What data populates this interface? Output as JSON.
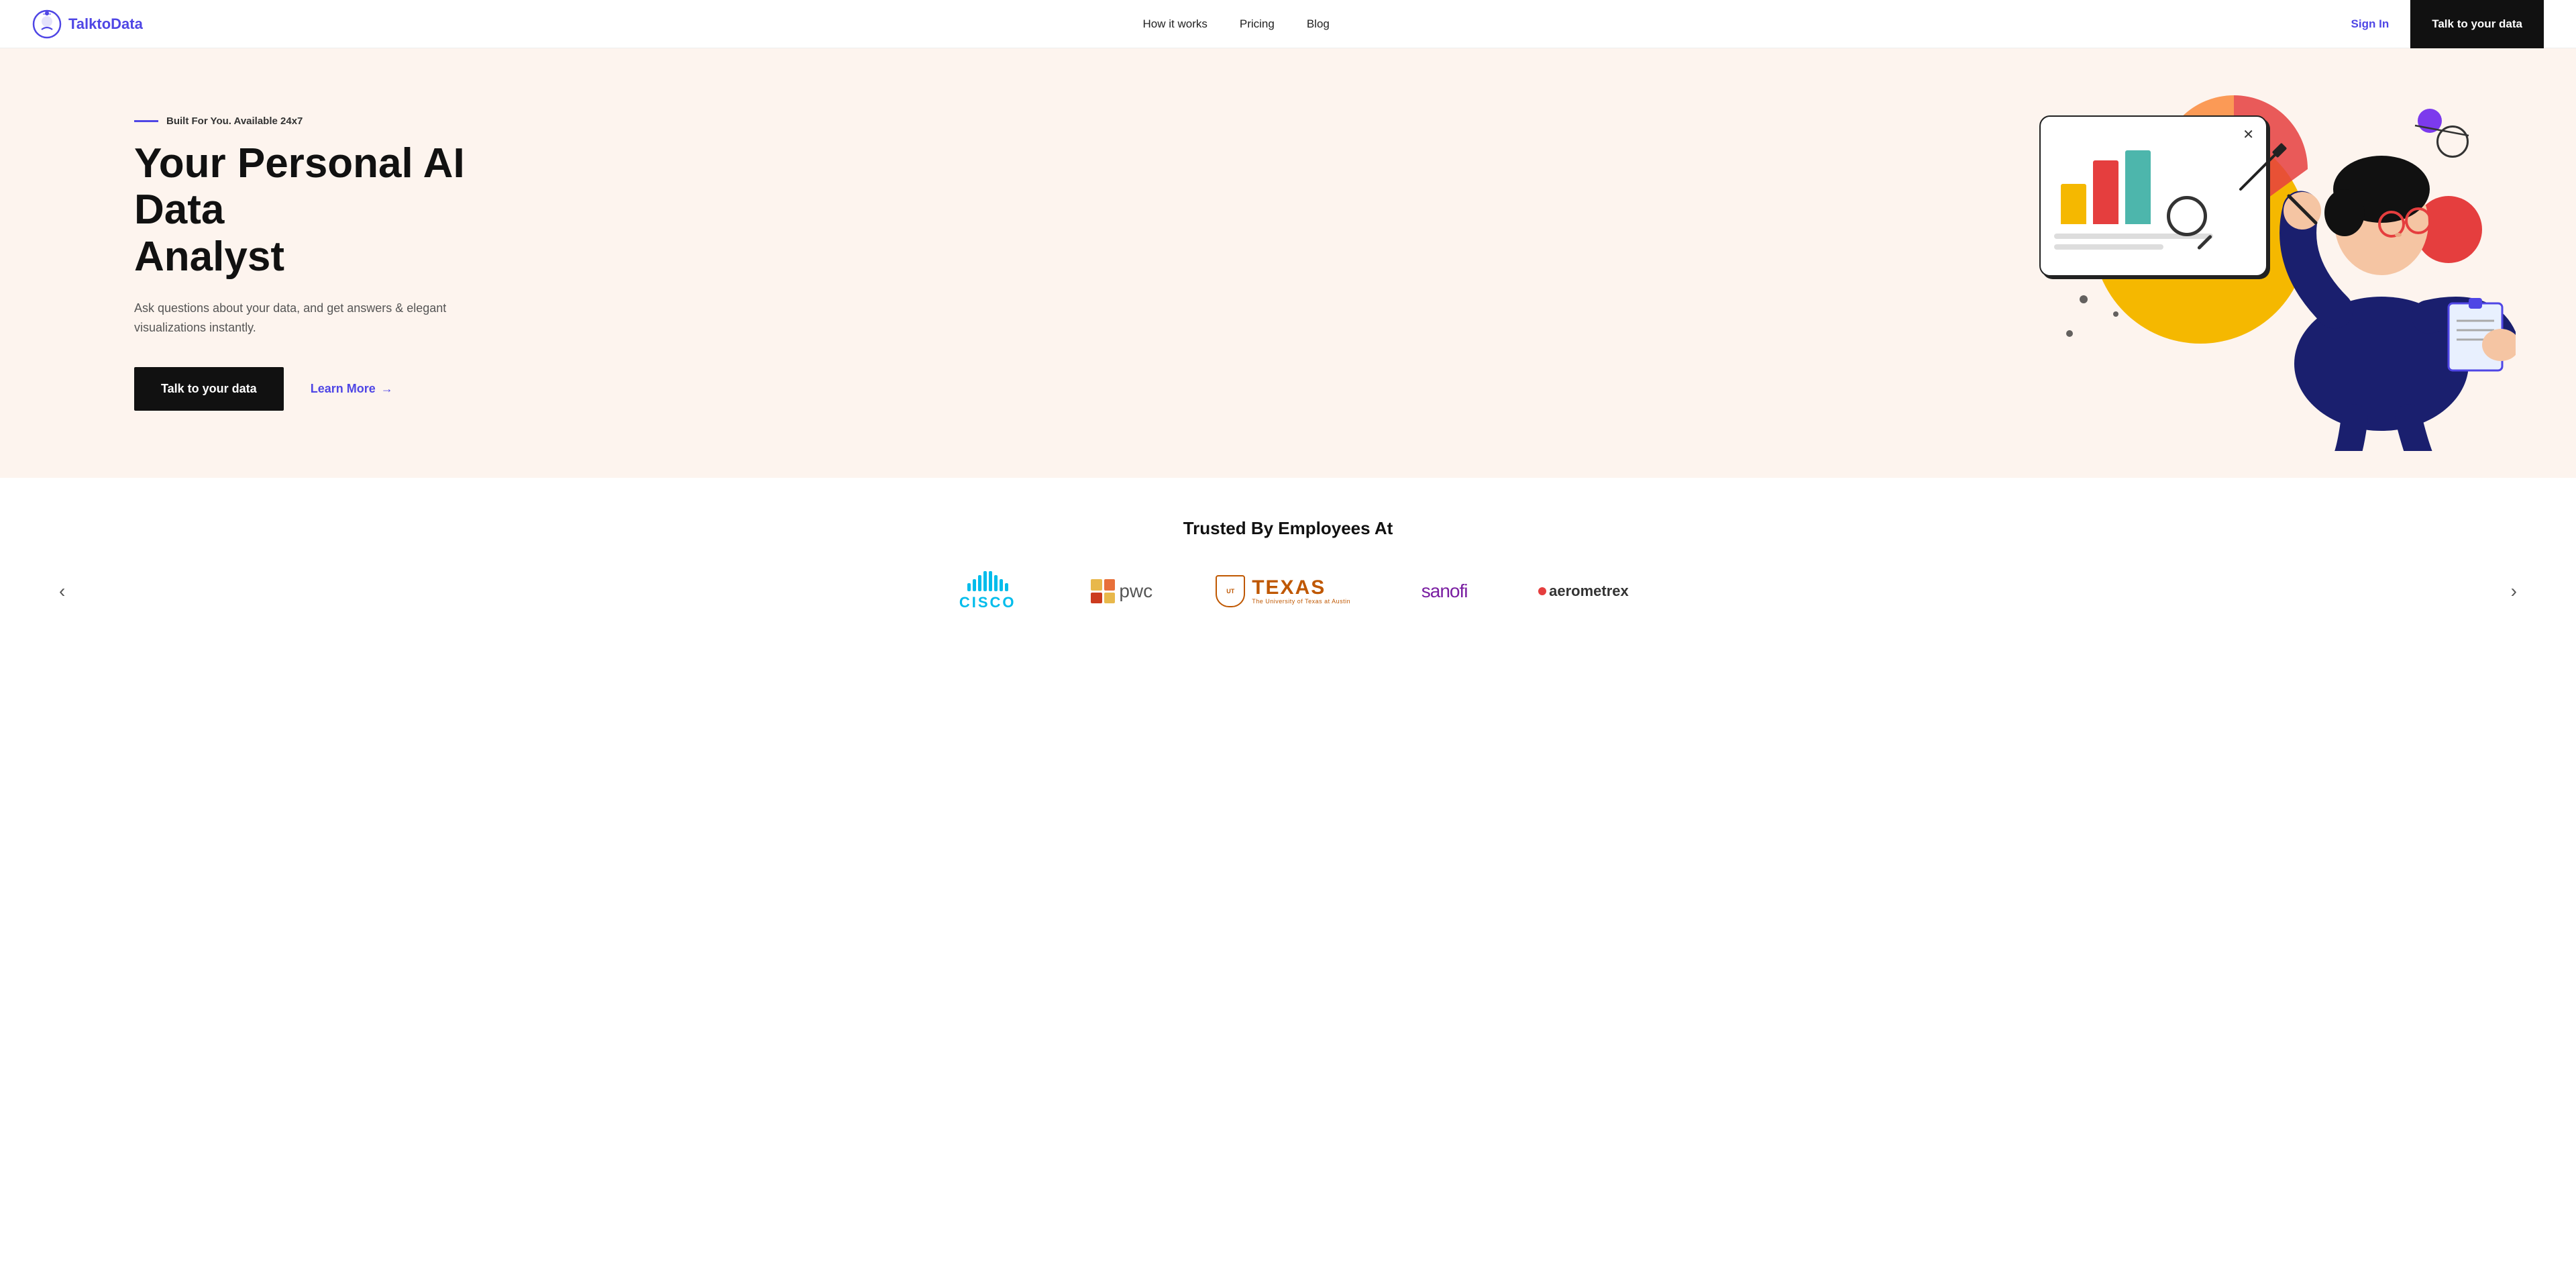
{
  "brand": {
    "name": "TalktoData",
    "logo_alt": "TalktoData logo"
  },
  "navbar": {
    "links": [
      {
        "label": "How it works",
        "href": "#"
      },
      {
        "label": "Pricing",
        "href": "#"
      },
      {
        "label": "Blog",
        "href": "#"
      }
    ],
    "signin_label": "Sign In",
    "cta_label": "Talk to your data"
  },
  "hero": {
    "tag": "Built For You. Available 24x7",
    "title_line1": "Your Personal AI Data",
    "title_line2": "Analyst",
    "subtitle": "Ask questions about your data, and get answers & elegant visualizations instantly.",
    "cta_label": "Talk to your data",
    "learn_more_label": "Learn More",
    "learn_more_arrow": "→"
  },
  "trusted": {
    "title": "Trusted By Employees At",
    "logos": [
      {
        "name": "Cisco",
        "type": "cisco"
      },
      {
        "name": "PwC",
        "type": "pwc"
      },
      {
        "name": "The University of Texas at Austin",
        "type": "texas"
      },
      {
        "name": "sanofi",
        "type": "sanofi"
      },
      {
        "name": "aerometrex",
        "type": "aerometrex"
      }
    ],
    "prev_label": "‹",
    "next_label": "›"
  },
  "chart": {
    "bars": [
      {
        "color": "#f5b800",
        "height": 60
      },
      {
        "color": "#e53e3e",
        "height": 95
      },
      {
        "color": "#4db6ac",
        "height": 110
      }
    ]
  }
}
